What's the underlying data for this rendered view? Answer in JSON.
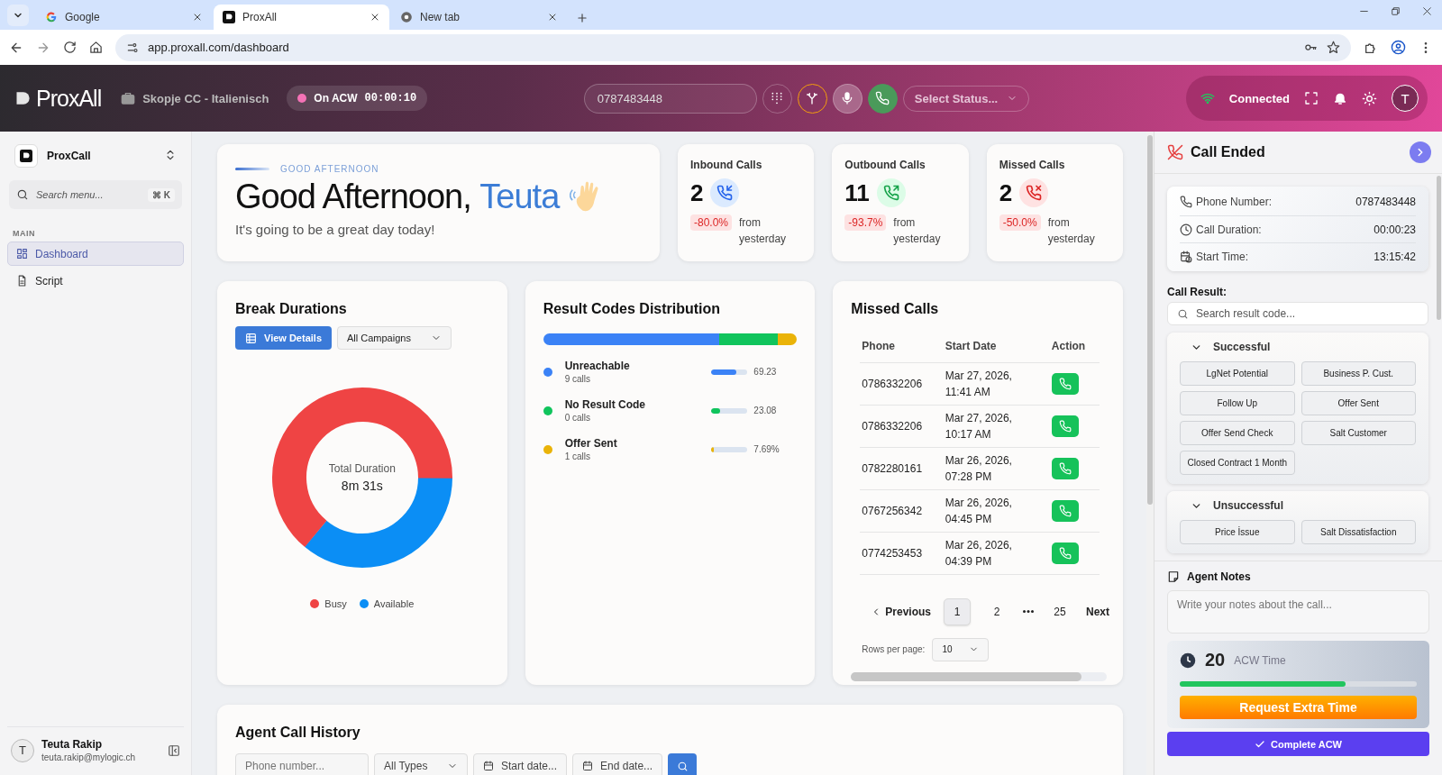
{
  "browser": {
    "tabs": [
      {
        "title": "Google",
        "kind": "google",
        "selected": false
      },
      {
        "title": "ProxAll",
        "kind": "app",
        "selected": true
      },
      {
        "title": "New tab",
        "kind": "chrome",
        "selected": false
      }
    ],
    "url": "app.proxall.com/dashboard"
  },
  "header": {
    "logo": "ProxAll",
    "workspace": "Skopje CC - Italienisch",
    "status_pill": {
      "label": "On ACW",
      "timer": "00:00:10"
    },
    "phone_input": {
      "value": "0787483448"
    },
    "status_select": {
      "placeholder": "Select Status..."
    },
    "connection": "Connected",
    "avatar": "T"
  },
  "sidebar": {
    "app_name": "ProxCall",
    "search": {
      "placeholder": "Search menu...",
      "shortcut": "⌘ K"
    },
    "section": "MAIN",
    "items": [
      {
        "label": "Dashboard",
        "kind": "grid",
        "selected": true
      },
      {
        "label": "Script",
        "kind": "file",
        "selected": false
      }
    ],
    "user": {
      "initial": "T",
      "name": "Teuta Rakip",
      "email": "teuta.rakip@mylogic.ch"
    }
  },
  "greeting": {
    "eyebrow": "GOOD AFTERNOON",
    "title": "Good Afternoon,",
    "name": "Teuta",
    "subtitle": "It's going to be a great day today!"
  },
  "stats": [
    {
      "title": "Inbound Calls",
      "value": "2",
      "kind": "inbound",
      "change": "-80.0%",
      "note": "from yesterday"
    },
    {
      "title": "Outbound Calls",
      "value": "11",
      "kind": "outbound",
      "change": "-93.7%",
      "note": "from yesterday"
    },
    {
      "title": "Missed Calls",
      "value": "2",
      "kind": "missed",
      "change": "-50.0%",
      "note": "from yesterday"
    }
  ],
  "break_durations": {
    "title": "Break Durations",
    "button": "View Details",
    "filter": "All Campaigns",
    "center_label": "Total Duration",
    "center_value": "8m 31s",
    "legend": [
      {
        "label": "Busy",
        "color": "#ef4444"
      },
      {
        "label": "Available",
        "color": "#0b8ef5"
      }
    ]
  },
  "result_codes": {
    "title": "Result Codes Distribution",
    "items": [
      {
        "label": "Unreachable",
        "count": "9 calls",
        "percent": "69.23",
        "level": 0.6923,
        "color": "#3b82f6"
      },
      {
        "label": "No Result Code",
        "count": "0 calls",
        "percent": "23.08",
        "level": 0.2308,
        "color": "#10c45c"
      },
      {
        "label": "Offer Sent",
        "count": "1 calls",
        "percent": "7.69%",
        "level": 0.0769,
        "color": "#eab308"
      }
    ]
  },
  "missed_calls": {
    "title": "Missed Calls",
    "columns": [
      "Phone",
      "Start Date",
      "Action"
    ],
    "rows": [
      {
        "phone": "0786332206",
        "date": "Mar 27, 2026, 11:41 AM"
      },
      {
        "phone": "0786332206",
        "date": "Mar 27, 2026, 10:17 AM"
      },
      {
        "phone": "0782280161",
        "date": "Mar 26, 2026, 07:28 PM"
      },
      {
        "phone": "0767256342",
        "date": "Mar 26, 2026, 04:45 PM"
      },
      {
        "phone": "0774253453",
        "date": "Mar 26, 2026, 04:39 PM"
      }
    ],
    "pagination": {
      "previous": "Previous",
      "pages": [
        {
          "kind": "page",
          "label": "1",
          "selected": true
        },
        {
          "kind": "page",
          "label": "2",
          "selected": false
        },
        {
          "kind": "gap"
        },
        {
          "kind": "page",
          "label": "25",
          "selected": false
        }
      ],
      "next": "Next"
    },
    "rows_per_page": {
      "label": "Rows per page:",
      "value": "10"
    }
  },
  "history": {
    "title": "Agent Call History",
    "phone_placeholder": "Phone number...",
    "type": "All Types",
    "start_placeholder": "Start date...",
    "end_placeholder": "End date..."
  },
  "call_panel": {
    "title": "Call Ended",
    "details": [
      {
        "label": "Phone Number:",
        "value": "0787483448",
        "kind": "phone"
      },
      {
        "label": "Call Duration:",
        "value": "00:00:23",
        "kind": "clock"
      },
      {
        "label": "Start Time:",
        "value": "13:15:42",
        "kind": "calendar"
      }
    ],
    "result_label": "Call Result:",
    "search_placeholder": "Search result code...",
    "groups": [
      {
        "title": "Successful",
        "expanded": true,
        "codes": [
          "LgNet Potential",
          "Business P. Cust.",
          "Follow Up",
          "Offer Sent",
          "Offer Send Check",
          "Salt Customer",
          "Closed Contract 1 Month"
        ]
      },
      {
        "title": "Unsuccessful",
        "expanded": true,
        "codes": [
          "Price İssue",
          "Salt Dissatisfaction"
        ]
      }
    ],
    "notes": {
      "title": "Agent Notes",
      "placeholder": "Write your notes about the call..."
    },
    "acw": {
      "seconds": "20",
      "label": "ACW Time",
      "level": 0.7
    },
    "extra_button": "Request Extra Time",
    "complete_button": "Complete ACW"
  }
}
